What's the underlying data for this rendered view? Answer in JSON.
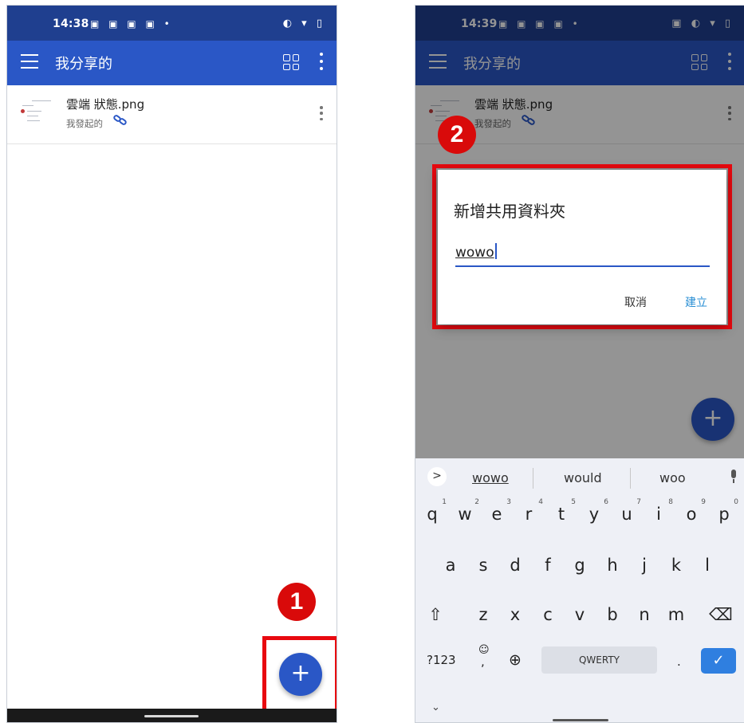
{
  "left": {
    "status_time": "14:38",
    "notif_icons": "▣ ▣ ▣ ▣ •",
    "sys_icons": "◐ ▾ ▯",
    "title": "我分享的",
    "file": {
      "name": "雲端 狀態.png",
      "sub": "我發起的"
    },
    "fab_label": "+",
    "callout": "1"
  },
  "right": {
    "status_time": "14:39",
    "notif_icons": "▣ ▣ ▣ ▣ •",
    "sys_icons": "▣ ◐ ▾ ▯",
    "title": "我分享的",
    "file": {
      "name": "雲端 狀態.png",
      "sub": "我發起的"
    },
    "fab_label": "+",
    "callout": "2",
    "dialog": {
      "title": "新增共用資料夾",
      "input_value": "wowo",
      "cancel": "取消",
      "create": "建立"
    },
    "keyboard": {
      "suggestions": [
        "wowo",
        "would",
        "woo"
      ],
      "row1": [
        "q",
        "w",
        "e",
        "r",
        "t",
        "y",
        "u",
        "i",
        "o",
        "p"
      ],
      "row1_nums": [
        "1",
        "2",
        "3",
        "4",
        "5",
        "6",
        "7",
        "8",
        "9",
        "0"
      ],
      "row2": [
        "a",
        "s",
        "d",
        "f",
        "g",
        "h",
        "j",
        "k",
        "l"
      ],
      "row3": [
        "z",
        "x",
        "c",
        "v",
        "b",
        "n",
        "m"
      ],
      "shift": "⇧",
      "backspace": "⌫",
      "symbols": "?123",
      "emoji": "☺",
      "comma": ",",
      "globe": "⊕",
      "space": "QWERTY",
      "period": ".",
      "enter": "✓",
      "arrow": ">",
      "collapse": "⌄"
    }
  }
}
